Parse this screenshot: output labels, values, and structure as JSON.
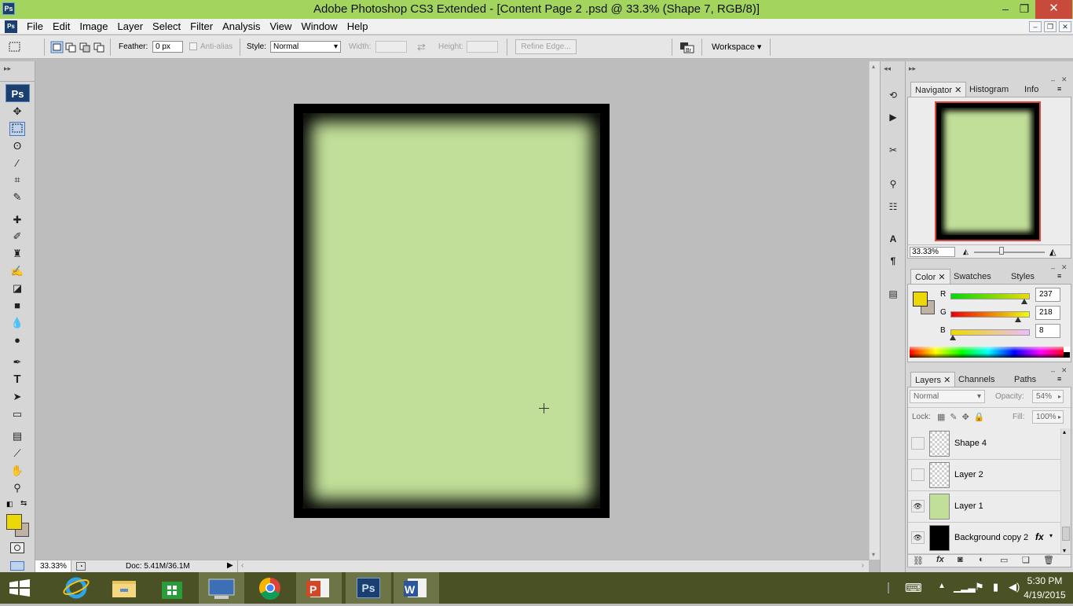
{
  "window": {
    "title": "Adobe Photoshop CS3 Extended - [Content Page 2 .psd @ 33.3% (Shape 7, RGB/8)]",
    "app_badge": "Ps",
    "minimize": "–",
    "maximize": "❐",
    "close": "✕"
  },
  "menu": [
    "File",
    "Edit",
    "Image",
    "Layer",
    "Select",
    "Filter",
    "Analysis",
    "View",
    "Window",
    "Help"
  ],
  "mdi": {
    "minimize": "–",
    "restore": "❐",
    "close": "✕"
  },
  "options": {
    "feather_label": "Feather:",
    "feather_value": "0 px",
    "antialias_label": "Anti-alias",
    "style_label": "Style:",
    "style_value": "Normal",
    "width_label": "Width:",
    "height_label": "Height:",
    "refine_edge": "Refine Edge...",
    "workspace": "Workspace"
  },
  "toolbox": {
    "logo": "Ps"
  },
  "status": {
    "zoom": "33.33%",
    "doc": "Doc: 5.41M/36.1M"
  },
  "navigator": {
    "tabs": [
      "Navigator",
      "Histogram",
      "Info"
    ],
    "zoom": "33.33%"
  },
  "color": {
    "tabs": [
      "Color",
      "Swatches",
      "Styles"
    ],
    "r_label": "R",
    "g_label": "G",
    "b_label": "B",
    "r": "237",
    "g": "218",
    "b": "8",
    "r_level": 0.93,
    "g_level": 0.855,
    "b_level": 0.03,
    "fg": "#ecd808",
    "bg": "#bfb1a3"
  },
  "layers": {
    "tabs": [
      "Layers",
      "Channels",
      "Paths"
    ],
    "blend": "Normal",
    "opacity_label": "Opacity:",
    "opacity": "54%",
    "lock_label": "Lock:",
    "fill_label": "Fill:",
    "fill": "100%",
    "items": [
      {
        "name": "Shape 4",
        "visible": false
      },
      {
        "name": "Layer 2",
        "visible": false
      },
      {
        "name": "Layer 1",
        "visible": true
      },
      {
        "name": "Background copy 2",
        "visible": true,
        "fx": "fx"
      }
    ]
  },
  "clock": {
    "time": "5:30 PM",
    "date": "4/19/2015"
  },
  "taskbar": {
    "apps": [
      "start",
      "ie",
      "explorer",
      "store",
      "remote-desktop",
      "chrome",
      "powerpoint",
      "photoshop",
      "word"
    ],
    "ps_label": "Ps",
    "ppt_label": "P",
    "word_label": "W"
  }
}
